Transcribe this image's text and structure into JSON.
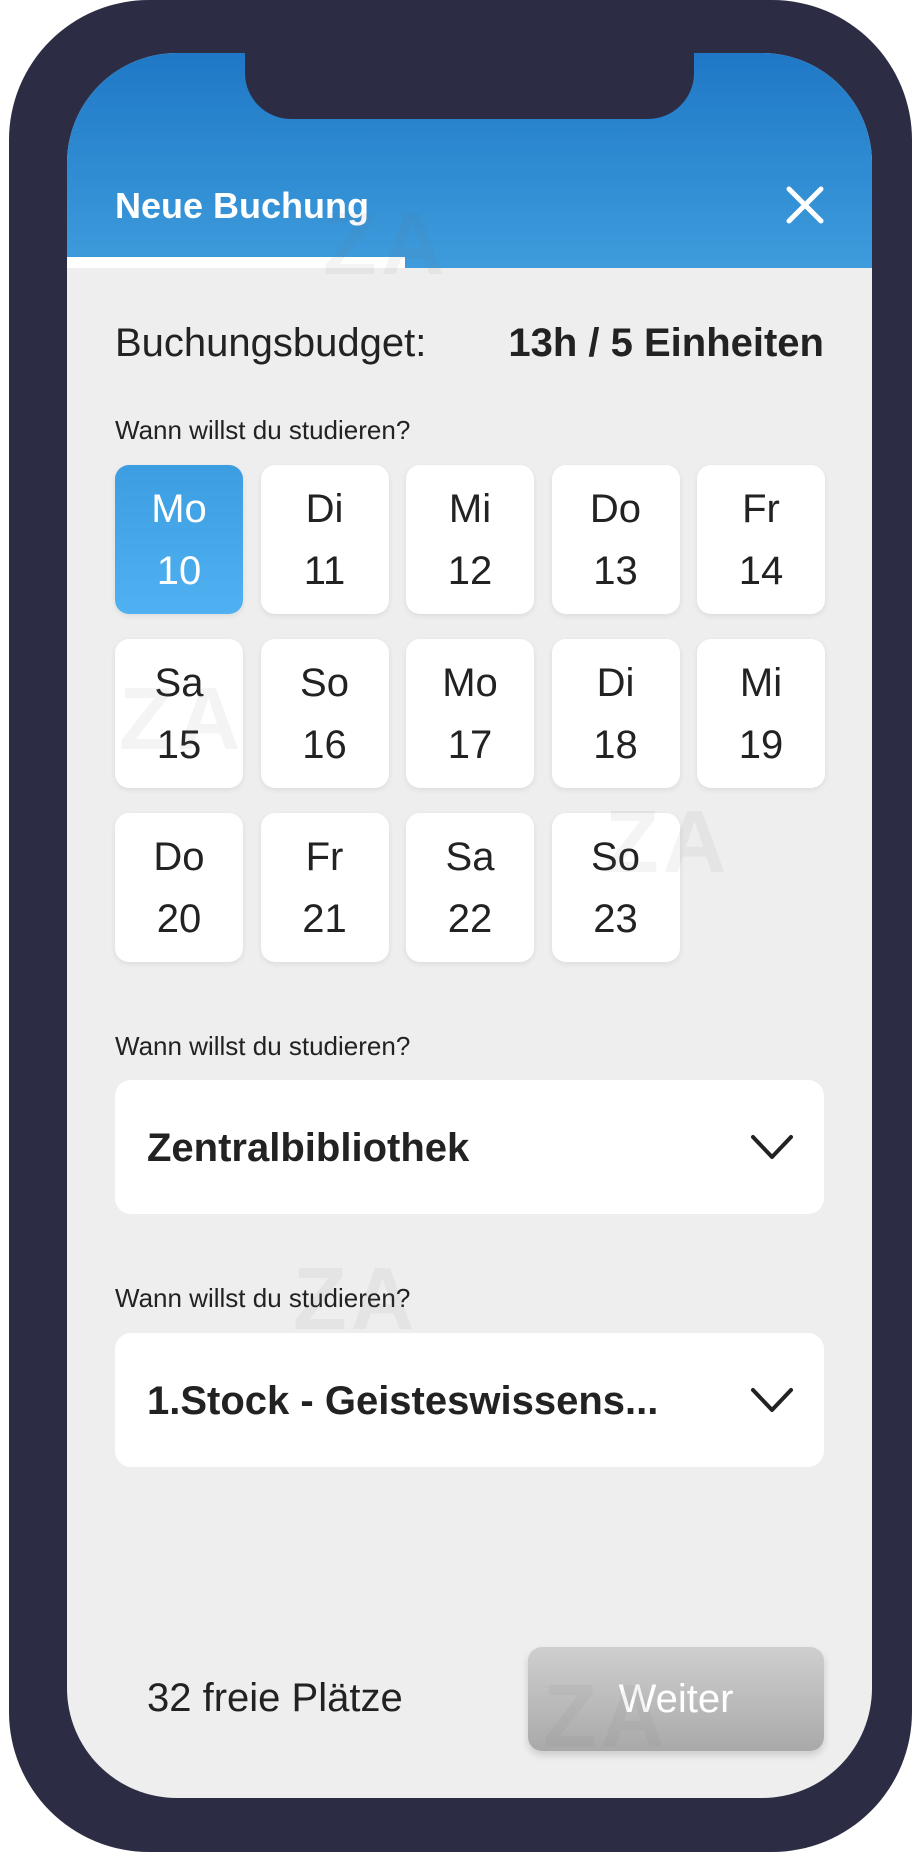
{
  "header": {
    "title": "Neue Buchung",
    "close_icon": "close-icon"
  },
  "progress": {
    "fraction": 0.42
  },
  "budget": {
    "label": "Buchungsbudget:",
    "value": "13h / 5 Einheiten"
  },
  "date_section": {
    "label": "Wann willst du studieren?",
    "days": [
      {
        "weekday": "Mo",
        "date": "10",
        "selected": true
      },
      {
        "weekday": "Di",
        "date": "11",
        "selected": false
      },
      {
        "weekday": "Mi",
        "date": "12",
        "selected": false
      },
      {
        "weekday": "Do",
        "date": "13",
        "selected": false
      },
      {
        "weekday": "Fr",
        "date": "14",
        "selected": false
      },
      {
        "weekday": "Sa",
        "date": "15",
        "selected": false
      },
      {
        "weekday": "So",
        "date": "16",
        "selected": false
      },
      {
        "weekday": "Mo",
        "date": "17",
        "selected": false
      },
      {
        "weekday": "Di",
        "date": "18",
        "selected": false
      },
      {
        "weekday": "Mi",
        "date": "19",
        "selected": false
      },
      {
        "weekday": "Do",
        "date": "20",
        "selected": false
      },
      {
        "weekday": "Fr",
        "date": "21",
        "selected": false
      },
      {
        "weekday": "Sa",
        "date": "22",
        "selected": false
      },
      {
        "weekday": "So",
        "date": "23",
        "selected": false
      }
    ]
  },
  "location_section": {
    "label": "Wann willst du studieren?",
    "value": "Zentralbibliothek",
    "icon": "chevron-down-icon"
  },
  "area_section": {
    "label": "Wann willst du studieren?",
    "value": "1.Stock - Geisteswissens...",
    "icon": "chevron-down-icon"
  },
  "footer": {
    "free_seats": "32 freie Plätze",
    "next_label": "Weiter"
  },
  "watermark": "ZA",
  "colors": {
    "frame": "#2c2d44",
    "header_top": "#1f78c6",
    "header_bottom": "#3e9cdc",
    "selected_day": "#4fb1f2",
    "button_disabled": "#b8b8b8"
  }
}
